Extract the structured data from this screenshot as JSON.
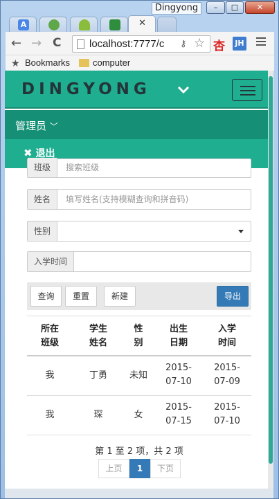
{
  "window": {
    "title": "Dingyong",
    "minimize": "–",
    "maximize": "□",
    "close": "✕"
  },
  "tabs": {
    "icons": [
      "translate-icon",
      "leaf-icon",
      "android-icon",
      "evernote-icon"
    ],
    "close": "✕"
  },
  "toolbar": {
    "back": "←",
    "forward": "→",
    "reload": "C",
    "url": "localhost:7777/c",
    "ext1": "杏",
    "ext2": "JH"
  },
  "bookmarks": {
    "bookmarks_label": "Bookmarks",
    "folder_label": "computer"
  },
  "navbar": {
    "brand": "DINGYONG"
  },
  "menu": {
    "admin": "管理员",
    "logout": "退出"
  },
  "form": {
    "class_label": "班级",
    "class_placeholder": "搜索班级",
    "name_label": "姓名",
    "name_placeholder": "填写姓名(支持模糊查询和拼音码)",
    "gender_label": "性别",
    "gender_value": "",
    "enroll_label": "入学时间",
    "enroll_value": ""
  },
  "actions": {
    "query": "查询",
    "reset": "重置",
    "create": "新建",
    "export": "导出"
  },
  "table": {
    "headers": [
      [
        "所在",
        "班级"
      ],
      [
        "学生",
        "姓名"
      ],
      [
        "性",
        "别"
      ],
      [
        "出生",
        "日期"
      ],
      [
        "入学",
        "时间"
      ]
    ],
    "rows": [
      [
        "我",
        "丁勇",
        "未知",
        [
          "2015-",
          "07-10"
        ],
        [
          "2015-",
          "07-09"
        ]
      ],
      [
        "我",
        "琛",
        "女",
        [
          "2015-",
          "07-15"
        ],
        [
          "2015-",
          "07-10"
        ]
      ]
    ]
  },
  "pagination": {
    "info": "第 1 至 2 项，共 2 项",
    "prev": "上页",
    "current": "1",
    "next": "下页"
  },
  "colors": {
    "primary": "#1fae90",
    "dark": "#158f75",
    "button": "#337ab7"
  }
}
